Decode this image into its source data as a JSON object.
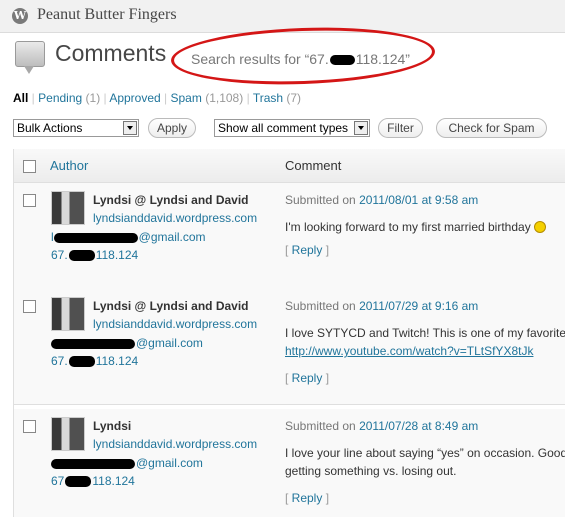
{
  "site": {
    "title": "Peanut Butter Fingers",
    "logo_glyph": "W"
  },
  "page": {
    "title": "Comments",
    "subtitle_prefix": "Search results for “67.",
    "subtitle_suffix": "118.124”"
  },
  "filters": [
    {
      "label": "All",
      "count": ""
    },
    {
      "label": "Pending",
      "count": "(1)"
    },
    {
      "label": "Approved",
      "count": ""
    },
    {
      "label": "Spam",
      "count": "(1,108)"
    },
    {
      "label": "Trash",
      "count": "(7)"
    }
  ],
  "toolbar": {
    "bulk_actions": "Bulk Actions",
    "apply": "Apply",
    "comment_types": "Show all comment types",
    "filter": "Filter",
    "check_spam": "Check for Spam"
  },
  "table": {
    "col_author": "Author",
    "col_comment": "Comment"
  },
  "comments": [
    {
      "author": "Lyndsi @ Lyndsi and David",
      "url": "lyndsianddavid.wordpress.com",
      "email_prefix": "l",
      "email_suffix": "@gmail.com",
      "ip_prefix": "67.",
      "ip_suffix": "118.124",
      "submitted_label": "Submitted on",
      "date": "2011/08/01 at 9:58 am",
      "text": "I'm looking forward to my first married birthday",
      "link": "",
      "reply": "Reply"
    },
    {
      "author": "Lyndsi @ Lyndsi and David",
      "url": "lyndsianddavid.wordpress.com",
      "email_prefix": "",
      "email_suffix": "@gmail.com",
      "ip_prefix": "67.",
      "ip_suffix": "118.124",
      "submitted_label": "Submitted on",
      "date": "2011/07/29 at 9:16 am",
      "text": "I love SYTYCD and Twitch! This is one of my favorite",
      "link": "http://www.youtube.com/watch?v=TLtSfYX8tJk",
      "reply": "Reply"
    },
    {
      "author": "Lyndsi",
      "url": "lyndsianddavid.wordpress.com",
      "email_prefix": "",
      "email_suffix": "@gmail.com",
      "ip_prefix": "67",
      "ip_suffix": "118.124",
      "submitted_label": "Submitted on",
      "date": "2011/07/28 at 8:49 am",
      "text": "I love your line about saying “yes” on occasion. Good\ngetting something vs. losing out.",
      "link": "",
      "reply": "Reply"
    }
  ]
}
